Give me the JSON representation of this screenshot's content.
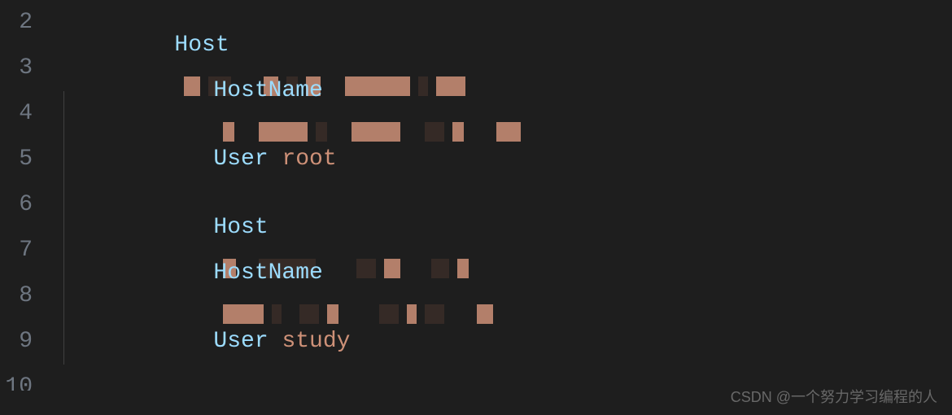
{
  "lines": {
    "2": "2",
    "3": "3",
    "4": "4",
    "5": "5",
    "6": "6",
    "7": "7",
    "8": "8",
    "9": "9",
    "10": "10"
  },
  "code": {
    "host1_keyword": "Host",
    "hostname1_keyword": "HostName",
    "user1_keyword": "User",
    "user1_value": "root",
    "host2_keyword": "Host",
    "hostname2_keyword": "HostName",
    "user2_keyword": "User",
    "user2_value": "study"
  },
  "watermark": "CSDN @一个努力学习编程的人"
}
